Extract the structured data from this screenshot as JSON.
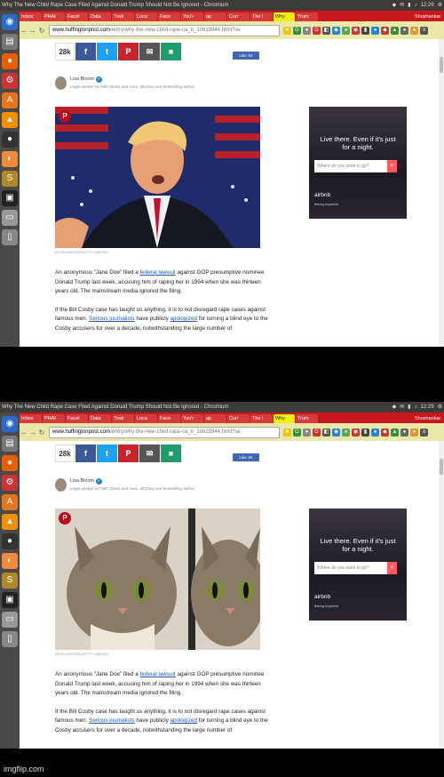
{
  "window": {
    "title": "Why The New Child Rape Case Filed Against Donald Trump Should Not Be Ignored - Chromium"
  },
  "system": {
    "time": "12:29",
    "user": "Shushankar"
  },
  "tabs": [
    {
      "label": "Inbox"
    },
    {
      "label": "PHAI"
    },
    {
      "label": "Facel"
    },
    {
      "label": "Data"
    },
    {
      "label": "Testi"
    },
    {
      "label": "Loca"
    },
    {
      "label": "Face"
    },
    {
      "label": "You'r"
    },
    {
      "label": "ap"
    },
    {
      "label": "Curr"
    },
    {
      "label": "The I"
    },
    {
      "label": "Why"
    },
    {
      "label": "Trum"
    }
  ],
  "address": {
    "host": "www.huffingtonpost.com",
    "path": "/entry/why-the-new-child-rape-ca_b_10619944.html?se"
  },
  "share": {
    "count": "28k",
    "fb": "f",
    "tw": "t",
    "pin": "P",
    "mail": "✉",
    "comment": "■",
    "like": "Like 1K"
  },
  "author": {
    "name": "Lisa Bloom",
    "bio": "Legal analyst for NBC News and Avvo, attorney and bestselling author"
  },
  "photo": {
    "caption": "KEVIN WINTER/GETTY IMAGES"
  },
  "ad": {
    "headline1": "Live there. Even if it's just",
    "headline2": "for a night.",
    "placeholder": "Where do you want to go?",
    "brand": "airbnb",
    "tagline": "Belong Anywhere"
  },
  "article": {
    "p1_a": "An anonymous \"Jane Doe\" filed a ",
    "p1_link": "federal lawsuit",
    "p1_b": " against GOP presumptive nominee Donald Trump last week, accusing him of raping her in 1994 when she was thirteen years old. The mainstream media ignored the filing.",
    "p2_a": "If the Bill Cosby case has taught us anything, it is to not disregard rape cases against famous men. ",
    "p2_link1": "Serious journalists",
    "p2_b": " have publicly ",
    "p2_link2": "apologized",
    "p2_c": " for turning a blind eye to the Cosby accusers for over a decade, notwithstanding the large number of"
  },
  "footer": {
    "watermark": "imgflip.com"
  }
}
